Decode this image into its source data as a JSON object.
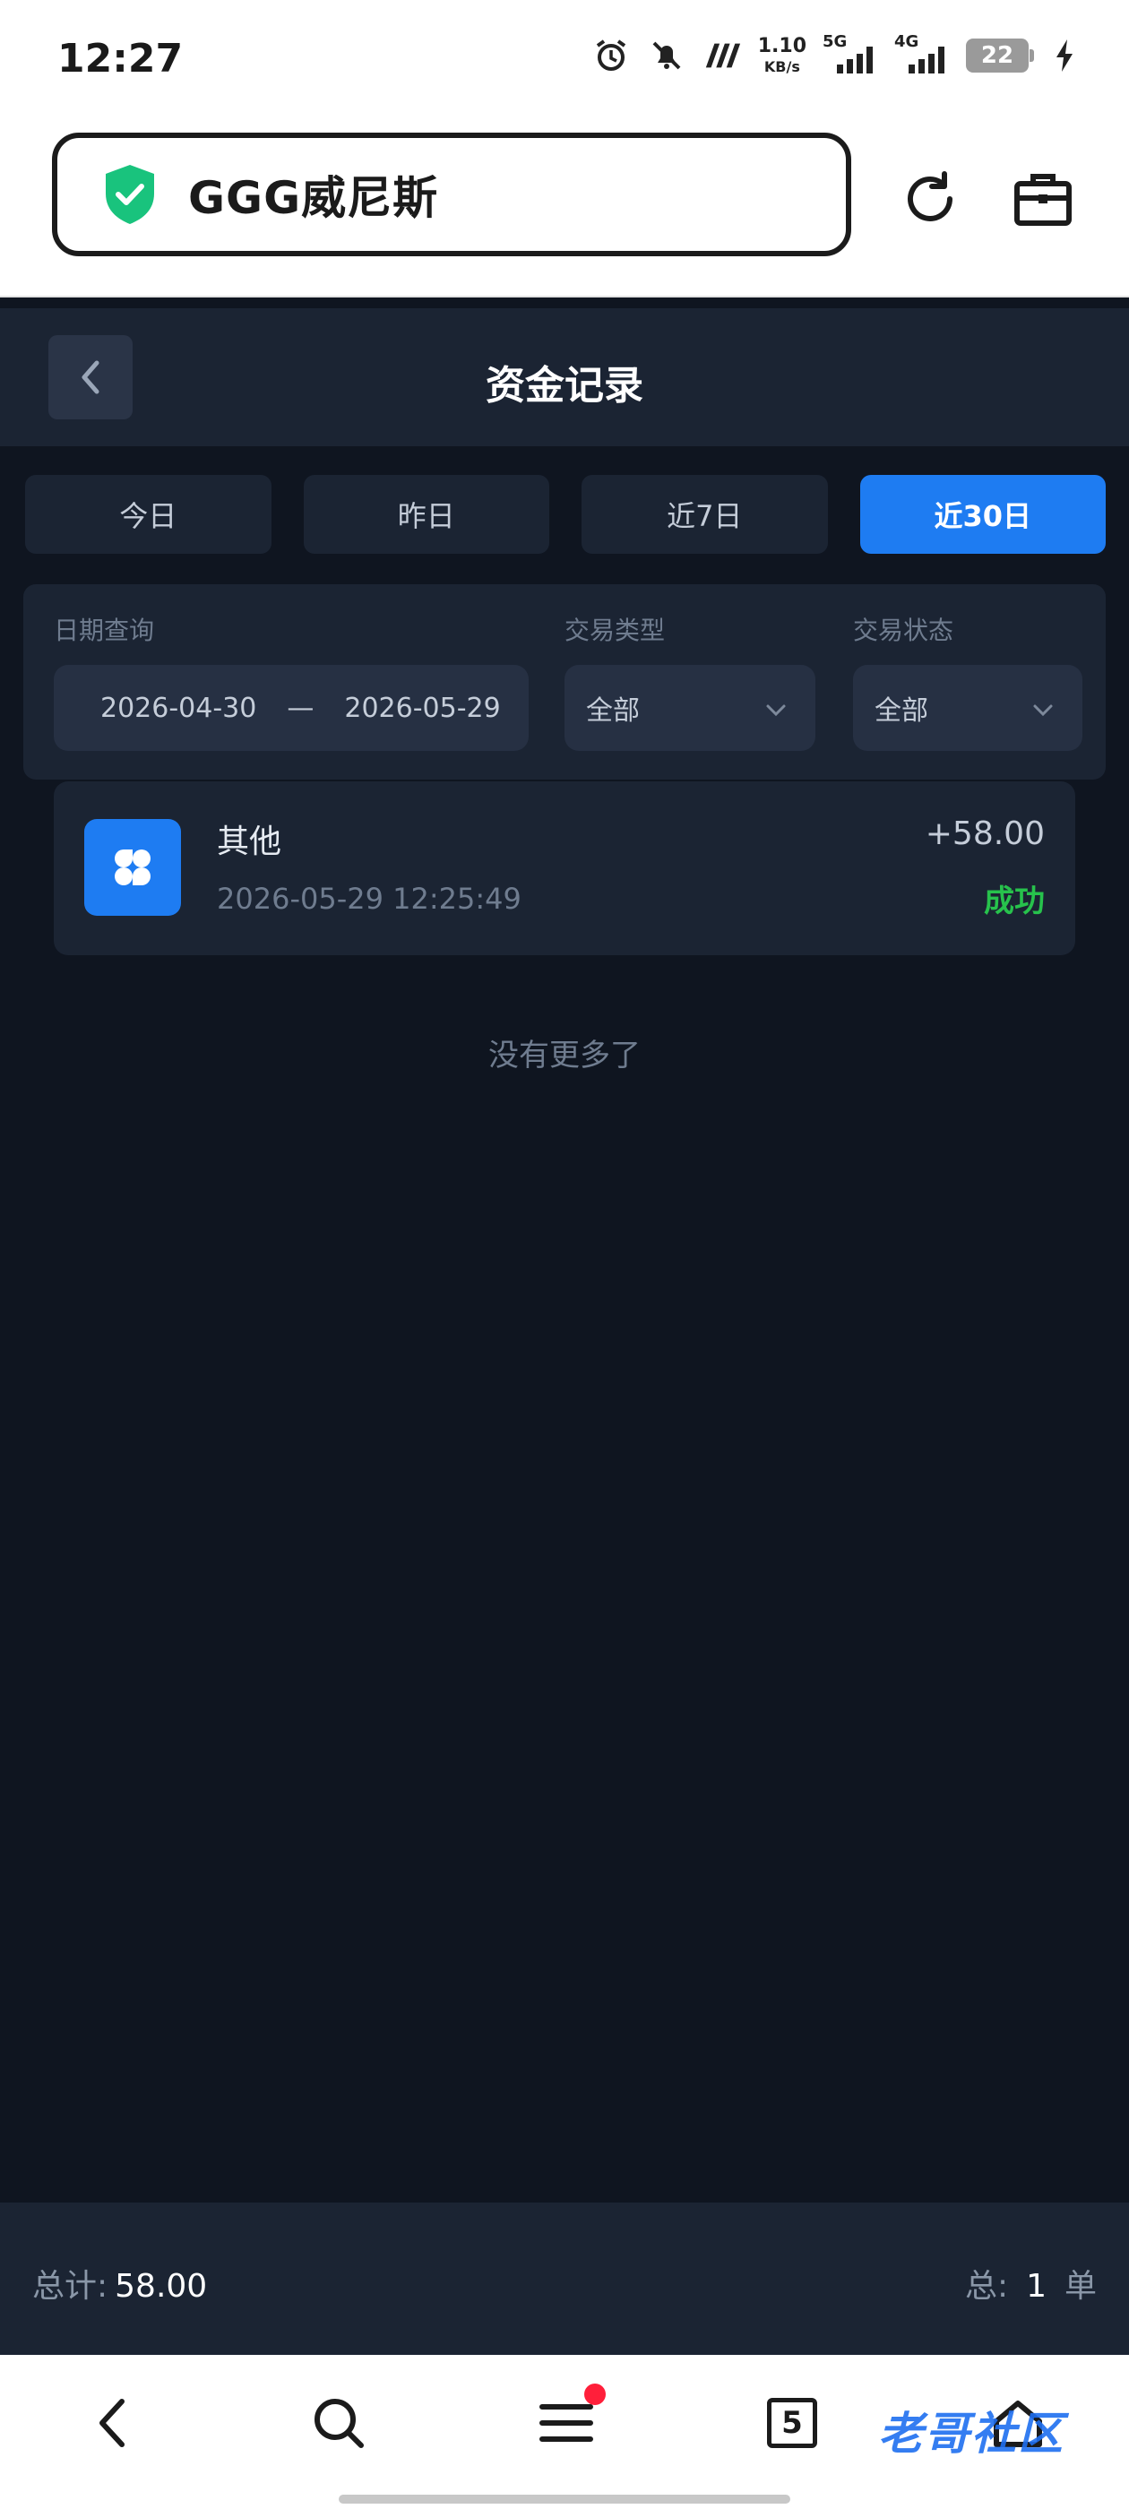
{
  "status_bar": {
    "time": "12:27",
    "net_speed_value": "1.10",
    "net_speed_unit": "KB/s",
    "sig1_label": "5G",
    "sig2_label": "4G",
    "battery": "22"
  },
  "browser": {
    "url_title": "GGG威尼斯"
  },
  "header": {
    "title": "资金记录"
  },
  "tabs": [
    {
      "label": "今日",
      "active": false
    },
    {
      "label": "昨日",
      "active": false
    },
    {
      "label": "近7日",
      "active": false
    },
    {
      "label": "近30日",
      "active": true
    }
  ],
  "filters": {
    "date_label": "日期查询",
    "date_start": "2026-04-30",
    "date_sep": "—",
    "date_end": "2026-05-29",
    "type_label": "交易类型",
    "type_value": "全部",
    "status_label": "交易状态",
    "status_value": "全部"
  },
  "records": [
    {
      "name": "其他",
      "time": "2026-05-29 12:25:49",
      "amount": "+58.00",
      "status": "成功"
    }
  ],
  "no_more": "没有更多了",
  "summary": {
    "total_label": "总计:",
    "total_value": "58.00",
    "count_label": "总:",
    "count_value": "1",
    "count_unit": "单"
  },
  "bottom_nav": {
    "tab_count": "5"
  },
  "watermark": "老哥社区",
  "colors": {
    "accent": "#1e7cf2",
    "success": "#27c24c",
    "background": "#0f1520",
    "panel": "#1b2433"
  }
}
